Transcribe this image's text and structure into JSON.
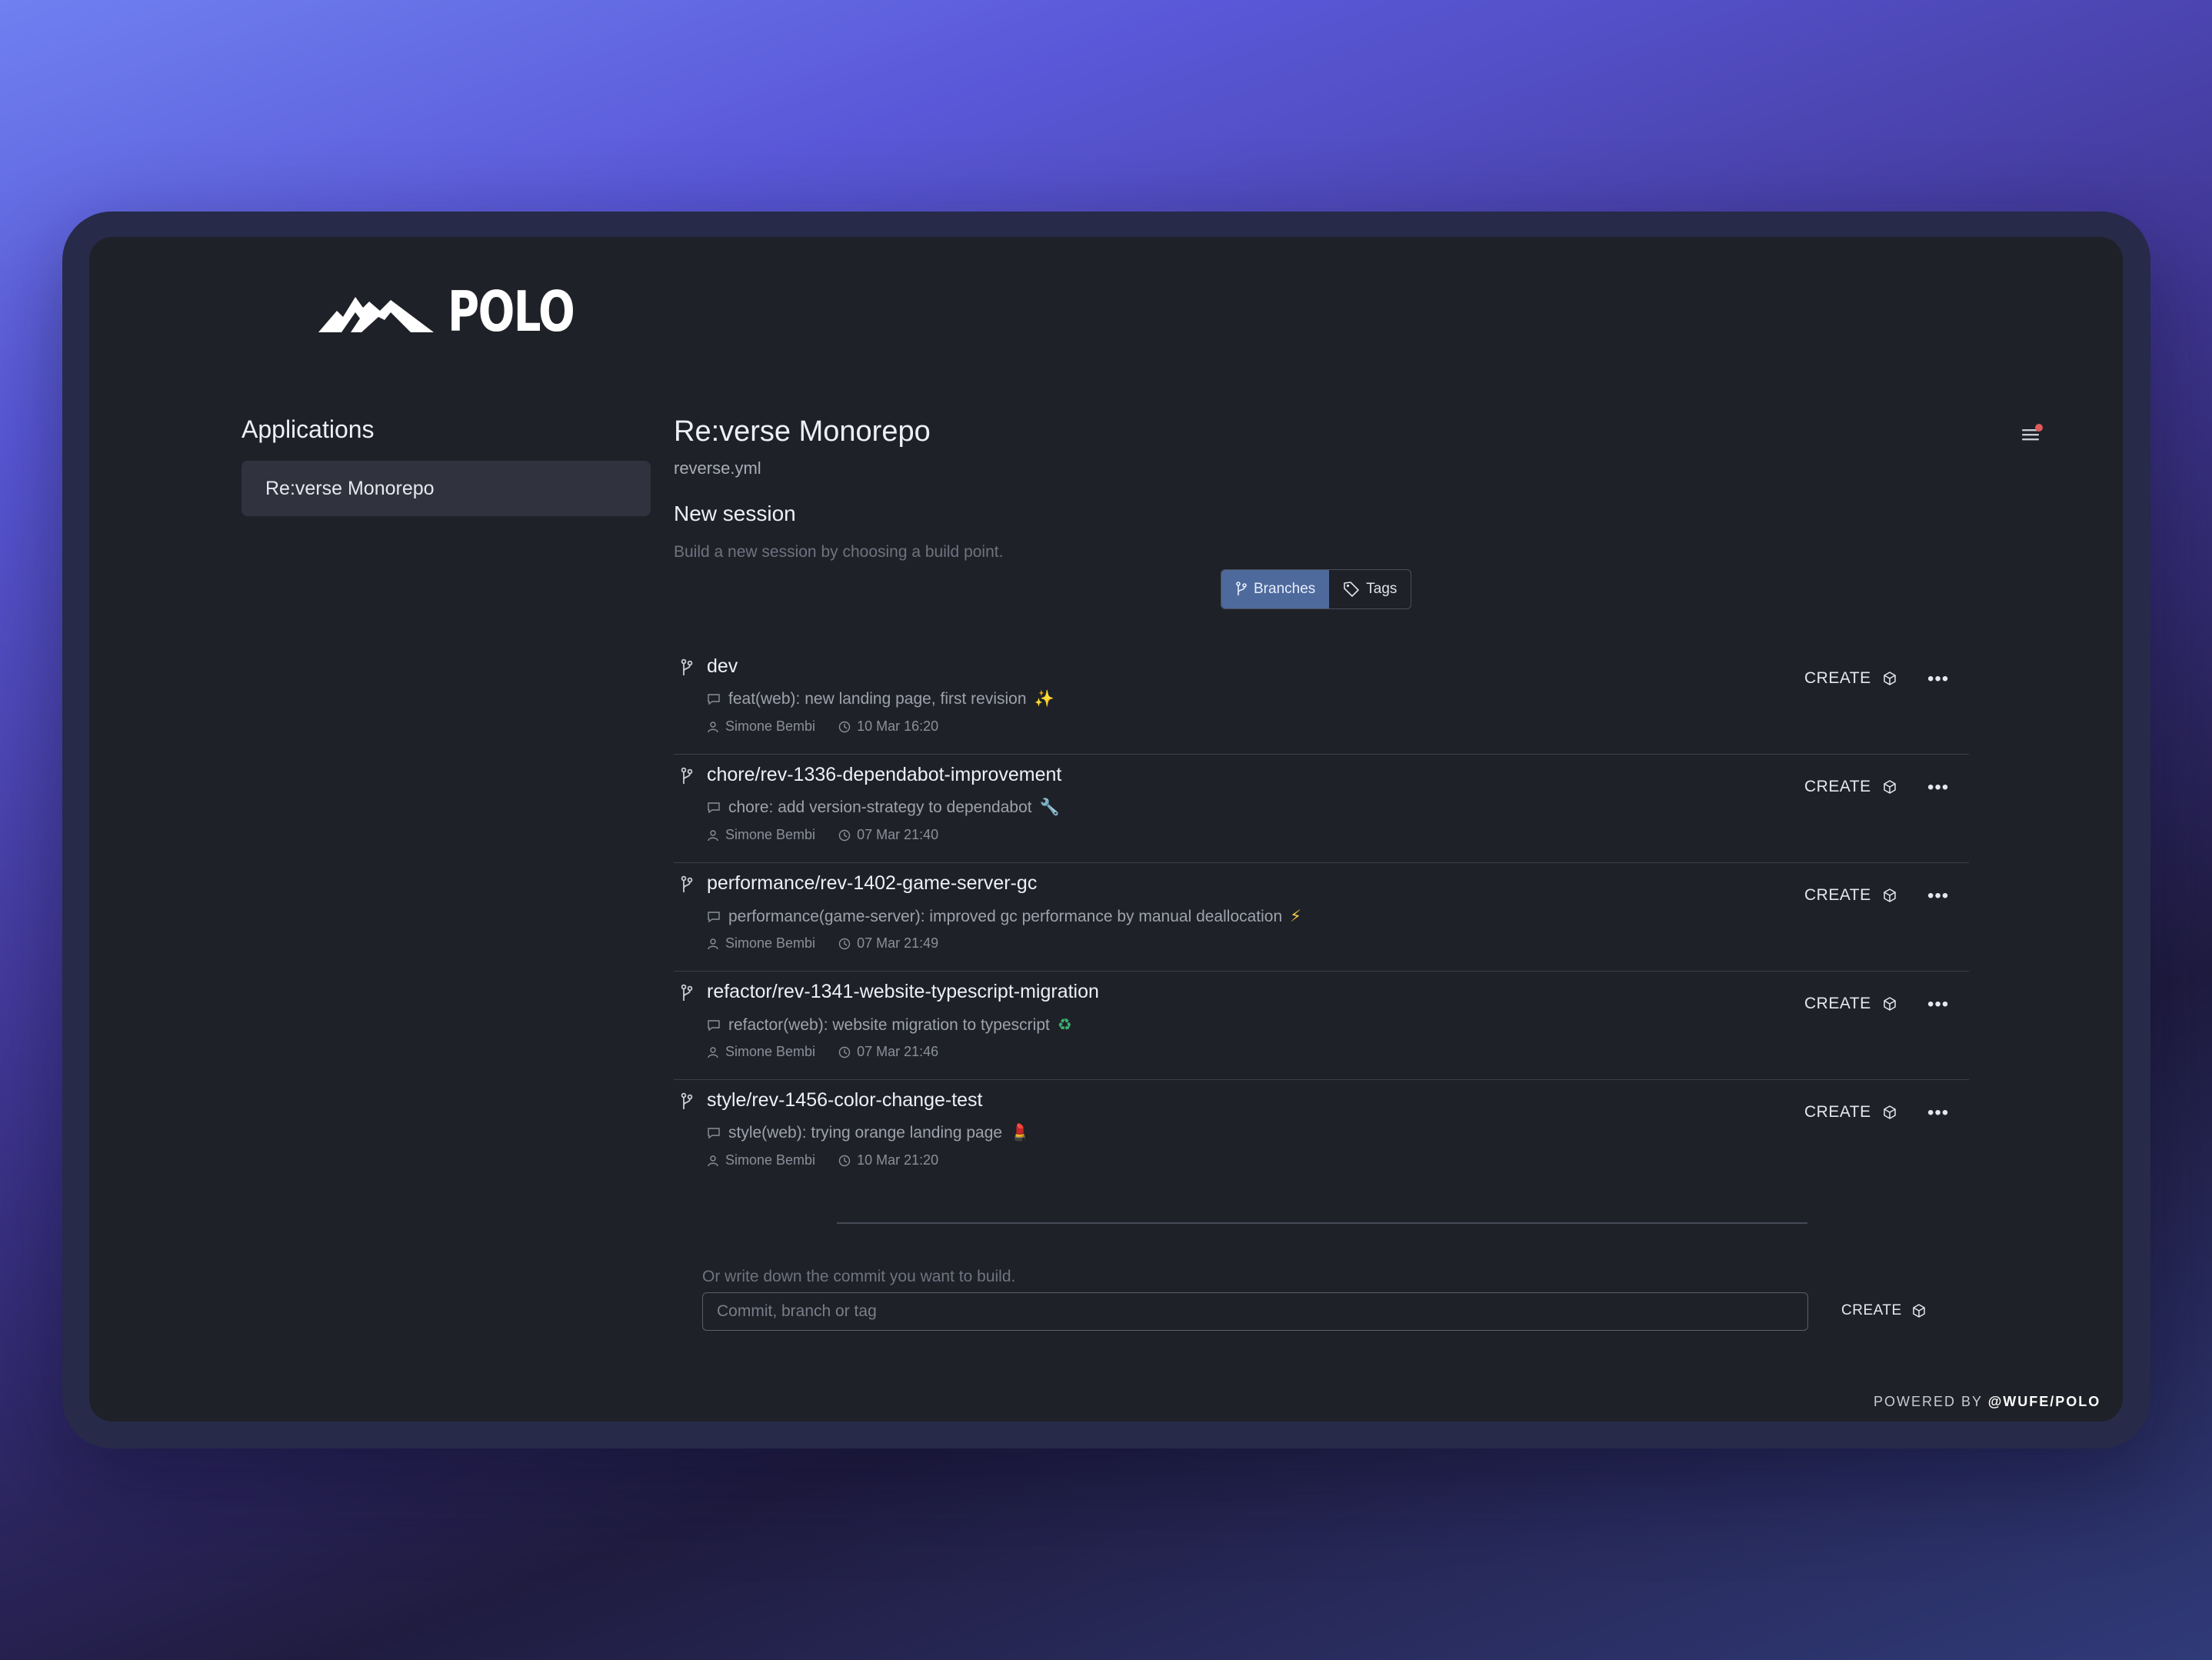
{
  "brand": {
    "name": "POLO"
  },
  "sidebar": {
    "title": "Applications",
    "items": [
      {
        "label": "Re:verse Monorepo"
      }
    ]
  },
  "app": {
    "title": "Re:verse Monorepo",
    "config_file": "reverse.yml"
  },
  "session": {
    "title": "New session",
    "description": "Build a new session by choosing a build point.",
    "tabs": [
      {
        "label": "Branches",
        "icon": "branch-icon",
        "active": true
      },
      {
        "label": "Tags",
        "icon": "tag-icon",
        "active": false
      }
    ]
  },
  "branches": [
    {
      "name": "dev",
      "message": "feat(web): new landing page, first revision",
      "emoji": "✨",
      "author": "Simone Bembi",
      "time": "10 Mar 16:20",
      "action": "CREATE"
    },
    {
      "name": "chore/rev-1336-dependabot-improvement",
      "message": "chore: add version-strategy to dependabot",
      "emoji": "🔧",
      "author": "Simone Bembi",
      "time": "07 Mar 21:40",
      "action": "CREATE"
    },
    {
      "name": "performance/rev-1402-game-server-gc",
      "message": "performance(game-server): improved gc performance by manual deallocation",
      "emoji": "⚡",
      "author": "Simone Bembi",
      "time": "07 Mar 21:49",
      "action": "CREATE"
    },
    {
      "name": "refactor/rev-1341-website-typescript-migration",
      "message": "refactor(web): website migration to typescript",
      "emoji": "♻",
      "author": "Simone Bembi",
      "time": "07 Mar 21:46",
      "action": "CREATE"
    },
    {
      "name": "style/rev-1456-color-change-test",
      "message": "style(web): trying orange landing page",
      "emoji": "💄",
      "author": "Simone Bembi",
      "time": "10 Mar 21:20",
      "action": "CREATE"
    }
  ],
  "commit": {
    "label": "Or write down the commit you want to build.",
    "placeholder": "Commit, branch or tag",
    "value": "",
    "action": "CREATE"
  },
  "footer": {
    "prefix": "POWERED BY",
    "handle": "@WUFE/POLO"
  },
  "colors": {
    "accent": "#4e6a9c",
    "notification": "#e05a5a",
    "window": "#1f2128"
  }
}
